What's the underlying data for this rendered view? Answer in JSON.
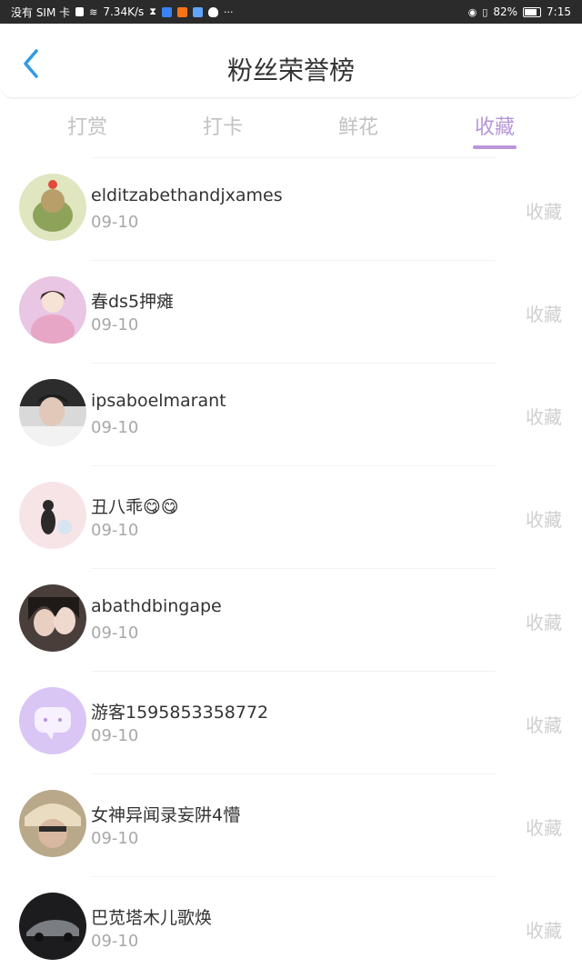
{
  "status_bar": {
    "left_text": "没有 SIM 卡",
    "speed": "7.34K/s",
    "battery": "82%",
    "time": "7:15"
  },
  "header": {
    "title": "粉丝荣誉榜",
    "back_icon": "chevron-left-icon"
  },
  "tabs": [
    {
      "label": "打赏",
      "active": false
    },
    {
      "label": "打卡",
      "active": false
    },
    {
      "label": "鲜花",
      "active": false
    },
    {
      "label": "收藏",
      "active": true
    }
  ],
  "colors": {
    "accent": "#b996d8",
    "back_arrow": "#2e9be6",
    "inactive_tab": "#c2c2c2"
  },
  "fans": [
    {
      "name": "elditzabethandjxames",
      "date": "09-10",
      "action": "收藏"
    },
    {
      "name": "春ds5押瘫",
      "date": "09-10",
      "action": "收藏"
    },
    {
      "name": "ipsaboelmarant",
      "date": "09-10",
      "action": "收藏"
    },
    {
      "name": "丑八乖😋😋",
      "date": "09-10",
      "action": "收藏"
    },
    {
      "name": "abathdbingape",
      "date": "09-10",
      "action": "收藏"
    },
    {
      "name": "游客1595853358772",
      "date": "09-10",
      "action": "收藏"
    },
    {
      "name": "女神异闻录妄阱4懵",
      "date": "09-10",
      "action": "收藏"
    },
    {
      "name": "巴苋塔木儿歌焕",
      "date": "09-10",
      "action": "收藏"
    }
  ]
}
